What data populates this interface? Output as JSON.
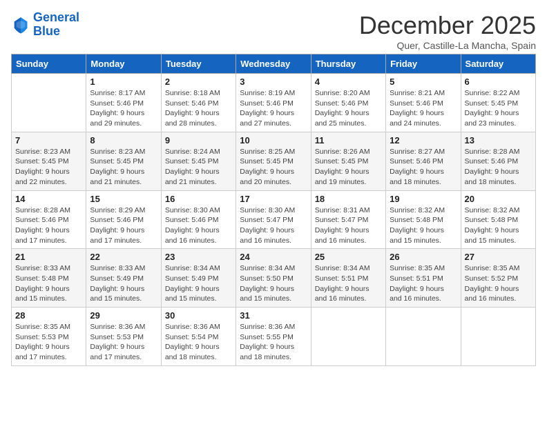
{
  "logo": {
    "line1": "General",
    "line2": "Blue"
  },
  "title": "December 2025",
  "subtitle": "Quer, Castille-La Mancha, Spain",
  "weekdays": [
    "Sunday",
    "Monday",
    "Tuesday",
    "Wednesday",
    "Thursday",
    "Friday",
    "Saturday"
  ],
  "weeks": [
    [
      {
        "day": "",
        "info": ""
      },
      {
        "day": "1",
        "sunrise": "8:17 AM",
        "sunset": "5:46 PM",
        "daylight": "9 hours and 29 minutes."
      },
      {
        "day": "2",
        "sunrise": "8:18 AM",
        "sunset": "5:46 PM",
        "daylight": "9 hours and 28 minutes."
      },
      {
        "day": "3",
        "sunrise": "8:19 AM",
        "sunset": "5:46 PM",
        "daylight": "9 hours and 27 minutes."
      },
      {
        "day": "4",
        "sunrise": "8:20 AM",
        "sunset": "5:46 PM",
        "daylight": "9 hours and 25 minutes."
      },
      {
        "day": "5",
        "sunrise": "8:21 AM",
        "sunset": "5:46 PM",
        "daylight": "9 hours and 24 minutes."
      },
      {
        "day": "6",
        "sunrise": "8:22 AM",
        "sunset": "5:45 PM",
        "daylight": "9 hours and 23 minutes."
      }
    ],
    [
      {
        "day": "7",
        "sunrise": "8:23 AM",
        "sunset": "5:45 PM",
        "daylight": "9 hours and 22 minutes."
      },
      {
        "day": "8",
        "sunrise": "8:23 AM",
        "sunset": "5:45 PM",
        "daylight": "9 hours and 21 minutes."
      },
      {
        "day": "9",
        "sunrise": "8:24 AM",
        "sunset": "5:45 PM",
        "daylight": "9 hours and 21 minutes."
      },
      {
        "day": "10",
        "sunrise": "8:25 AM",
        "sunset": "5:45 PM",
        "daylight": "9 hours and 20 minutes."
      },
      {
        "day": "11",
        "sunrise": "8:26 AM",
        "sunset": "5:45 PM",
        "daylight": "9 hours and 19 minutes."
      },
      {
        "day": "12",
        "sunrise": "8:27 AM",
        "sunset": "5:46 PM",
        "daylight": "9 hours and 18 minutes."
      },
      {
        "day": "13",
        "sunrise": "8:28 AM",
        "sunset": "5:46 PM",
        "daylight": "9 hours and 18 minutes."
      }
    ],
    [
      {
        "day": "14",
        "sunrise": "8:28 AM",
        "sunset": "5:46 PM",
        "daylight": "9 hours and 17 minutes."
      },
      {
        "day": "15",
        "sunrise": "8:29 AM",
        "sunset": "5:46 PM",
        "daylight": "9 hours and 17 minutes."
      },
      {
        "day": "16",
        "sunrise": "8:30 AM",
        "sunset": "5:46 PM",
        "daylight": "9 hours and 16 minutes."
      },
      {
        "day": "17",
        "sunrise": "8:30 AM",
        "sunset": "5:47 PM",
        "daylight": "9 hours and 16 minutes."
      },
      {
        "day": "18",
        "sunrise": "8:31 AM",
        "sunset": "5:47 PM",
        "daylight": "9 hours and 16 minutes."
      },
      {
        "day": "19",
        "sunrise": "8:32 AM",
        "sunset": "5:48 PM",
        "daylight": "9 hours and 15 minutes."
      },
      {
        "day": "20",
        "sunrise": "8:32 AM",
        "sunset": "5:48 PM",
        "daylight": "9 hours and 15 minutes."
      }
    ],
    [
      {
        "day": "21",
        "sunrise": "8:33 AM",
        "sunset": "5:48 PM",
        "daylight": "9 hours and 15 minutes."
      },
      {
        "day": "22",
        "sunrise": "8:33 AM",
        "sunset": "5:49 PM",
        "daylight": "9 hours and 15 minutes."
      },
      {
        "day": "23",
        "sunrise": "8:34 AM",
        "sunset": "5:49 PM",
        "daylight": "9 hours and 15 minutes."
      },
      {
        "day": "24",
        "sunrise": "8:34 AM",
        "sunset": "5:50 PM",
        "daylight": "9 hours and 15 minutes."
      },
      {
        "day": "25",
        "sunrise": "8:34 AM",
        "sunset": "5:51 PM",
        "daylight": "9 hours and 16 minutes."
      },
      {
        "day": "26",
        "sunrise": "8:35 AM",
        "sunset": "5:51 PM",
        "daylight": "9 hours and 16 minutes."
      },
      {
        "day": "27",
        "sunrise": "8:35 AM",
        "sunset": "5:52 PM",
        "daylight": "9 hours and 16 minutes."
      }
    ],
    [
      {
        "day": "28",
        "sunrise": "8:35 AM",
        "sunset": "5:53 PM",
        "daylight": "9 hours and 17 minutes."
      },
      {
        "day": "29",
        "sunrise": "8:36 AM",
        "sunset": "5:53 PM",
        "daylight": "9 hours and 17 minutes."
      },
      {
        "day": "30",
        "sunrise": "8:36 AM",
        "sunset": "5:54 PM",
        "daylight": "9 hours and 18 minutes."
      },
      {
        "day": "31",
        "sunrise": "8:36 AM",
        "sunset": "5:55 PM",
        "daylight": "9 hours and 18 minutes."
      },
      {
        "day": "",
        "info": ""
      },
      {
        "day": "",
        "info": ""
      },
      {
        "day": "",
        "info": ""
      }
    ]
  ]
}
